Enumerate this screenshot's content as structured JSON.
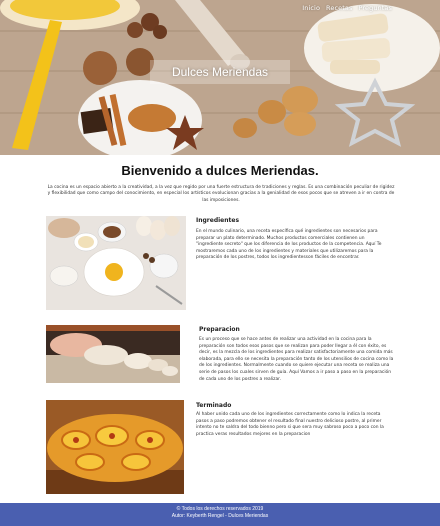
{
  "nav": {
    "items": [
      {
        "label": "Inicio"
      },
      {
        "label": "Recetas"
      },
      {
        "label": "Preguntas"
      }
    ]
  },
  "hero": {
    "title": "Dulces Meriendas"
  },
  "page": {
    "heading": "Bienvenido a dulces Meriendas."
  },
  "intro": {
    "text": "La cocina es un espacio abierto a la creatividad, a la vez que regido por una fuerte estructura de tradiciones y reglas. Es una combinación peculiar de rigidez y flexibilidad que como campo del conocimiento, en especial los artísticos evolucionan gracias a la genialidad de esos pocos que se atreven a ir en contra de las imposiciones."
  },
  "sections": [
    {
      "title": "Ingredientes",
      "text": "En el mundo culinario, una receta específica qué ingredientes son necesarios para preparar un plato determinado. Muchos productos comerciales contienen un \"ingrediente secreto\" que los diferencia de los productos de la competencia. Aquí Te mostraremos cada uno de los ingredientes y materiales que utilizaremos para la preparación de los postres, todos los ingredientesson fáciles de encontrar."
    },
    {
      "title": "Preparacion",
      "text": "Es un proceso que se hace antes de realizar una actividad en la cocina para la preparación son todos esos pasos que se realizan para poder llegar a él con éxito, es decir, es la mezcla de los ingredientes para realizar satisfactoriamente una comida más elaborada, para ello se necesita la preparación tanto de los utensilios de cocina como la de los ingredientes. Normalmente cuando se quiere ejecutar una receta se realiza una serie de pasos los cuales sirven de guía. Aquí Vamos a ir paso a paso en la preparación de cada uno de los postres a realizar."
    },
    {
      "title": "Terminado",
      "text": "Al haber unido cada uno de los ingredientes correctamente como lo indica la receta pasos a paso podremos obtener el resultado final nuestro delicioso postre, al primer intento no te saldra del todo bienno pero si que sera muy sabroso poco a poco con la practica veras resultados mejores en la preparacion"
    }
  ],
  "footer": {
    "copyright": "© Todos los derechos reservados 2019",
    "author": "Autor: Keyberth Rengel - Dulces Meriendas"
  }
}
